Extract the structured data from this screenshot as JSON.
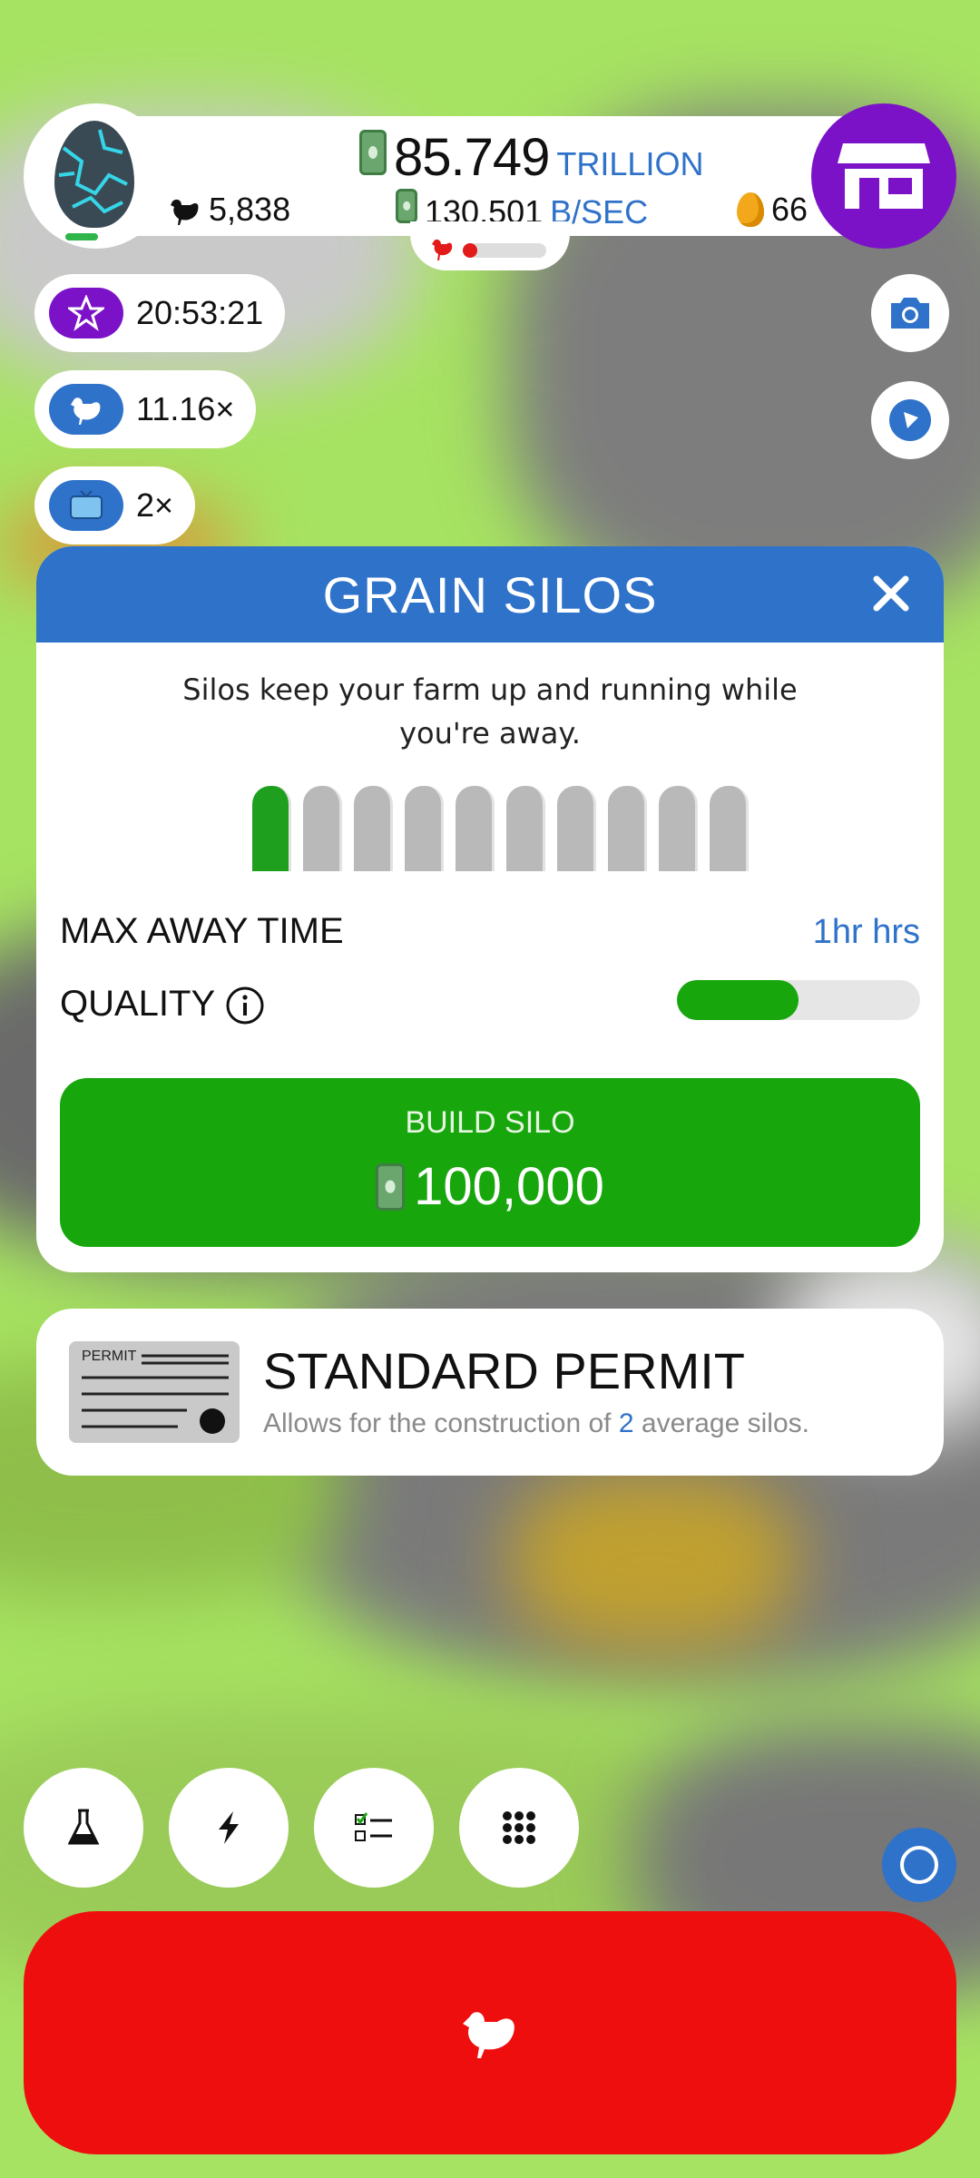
{
  "colors": {
    "accent_blue": "#2f72c9",
    "shop_purple": "#7b12c8",
    "build_green": "#18a60d",
    "hatch_red": "#ef0e0e"
  },
  "header": {
    "money_value": "85.749",
    "money_unit": "TRILLION",
    "rate_value": "130.501",
    "rate_unit": "B/SEC",
    "chicken_count": "5,838",
    "golden_eggs": "66"
  },
  "boosts": [
    {
      "icon": "star-icon",
      "label": "20:53:21"
    },
    {
      "icon": "chicken-icon",
      "label": "11.16×"
    },
    {
      "icon": "tv-icon",
      "label": "2×"
    }
  ],
  "silo_panel": {
    "title": "GRAIN SILOS",
    "description": "Silos keep your farm up and running while you're away.",
    "silos_built": 1,
    "silos_total": 10,
    "max_away_label": "MAX AWAY TIME",
    "max_away_value": "1hr hrs",
    "quality_label": "QUALITY",
    "quality_fraction": 0.5,
    "build_label": "BUILD SILO",
    "build_price": "100,000"
  },
  "permit": {
    "image_text": "PERMIT",
    "title": "STANDARD PERMIT",
    "desc_before": "Allows for the construction of",
    "desc_number": "2",
    "desc_after": "average silos."
  },
  "toolbar": [
    {
      "icon": "flask-icon"
    },
    {
      "icon": "lightning-icon"
    },
    {
      "icon": "checklist-icon"
    },
    {
      "icon": "grid-icon"
    }
  ]
}
